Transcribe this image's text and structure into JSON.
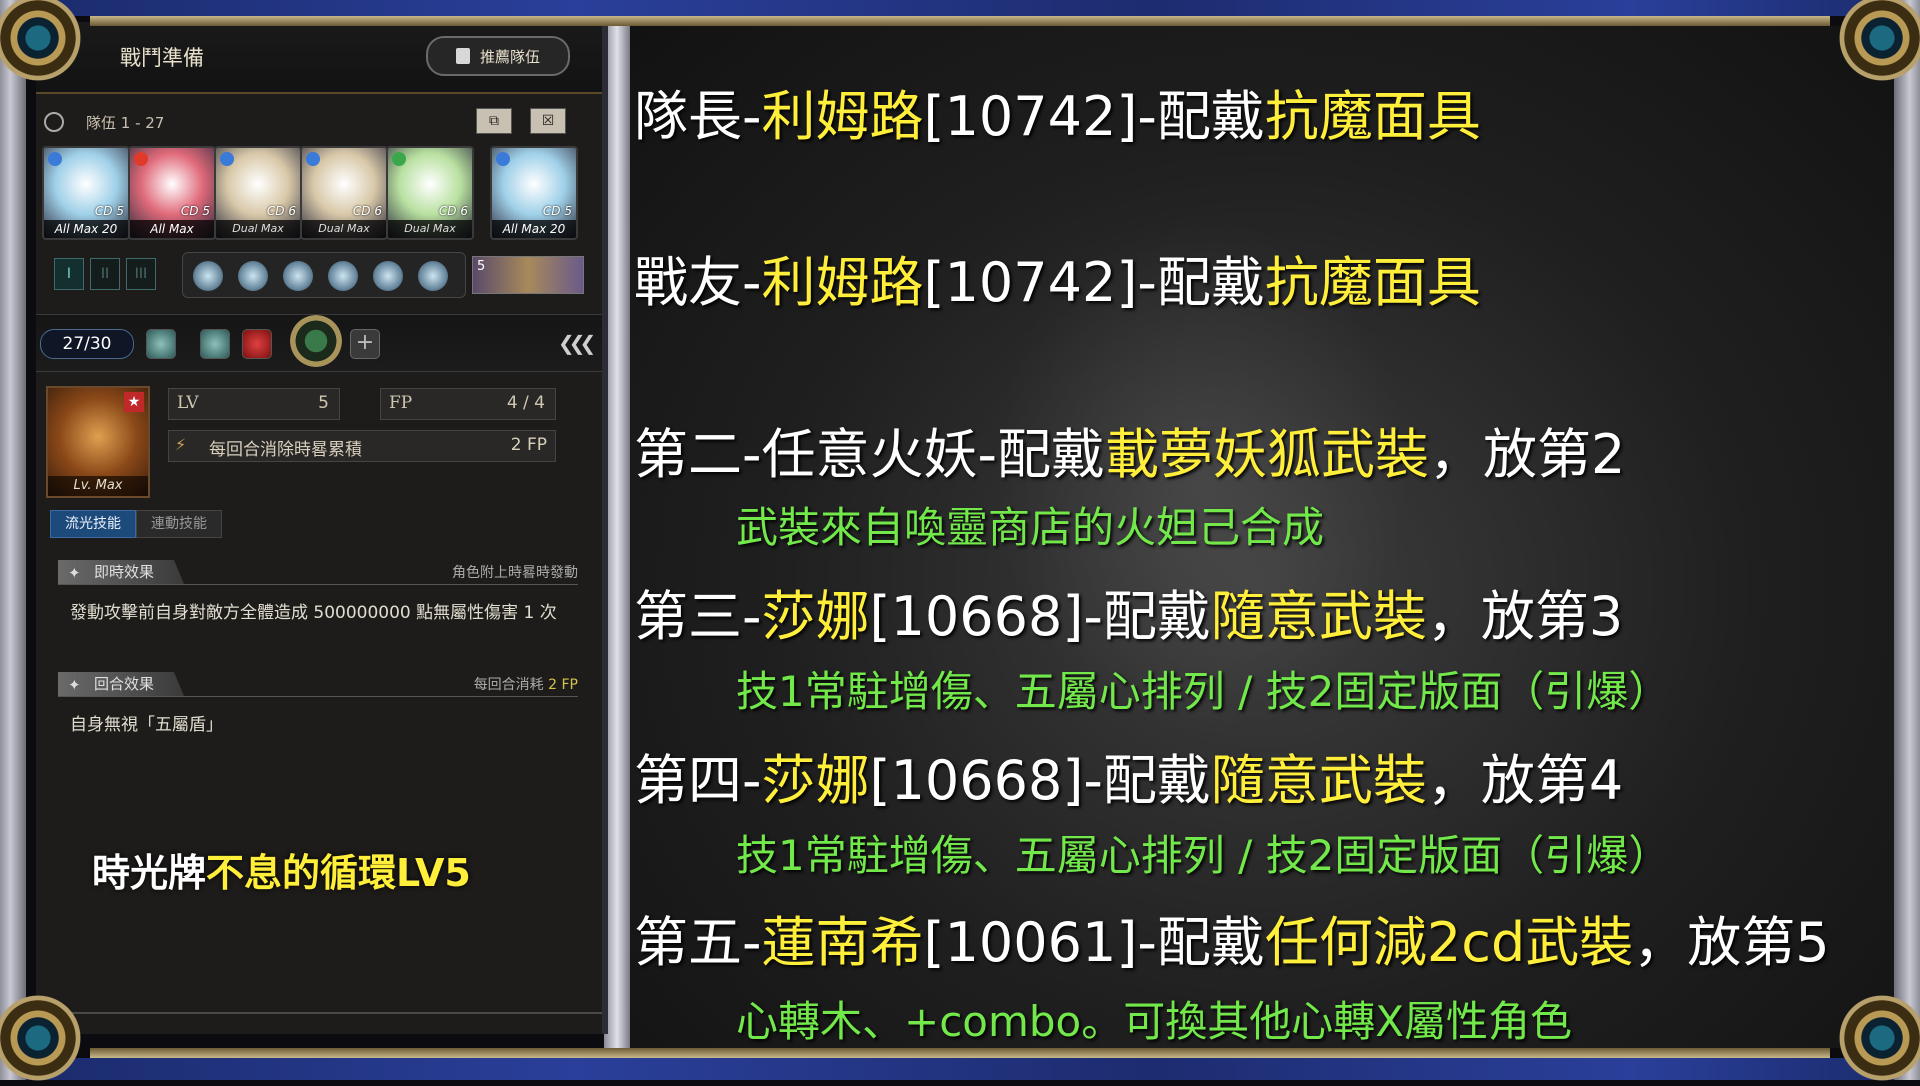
{
  "panel": {
    "title": "戰鬥準備",
    "recommend_btn": "推薦隊伍",
    "team_label": "隊伍 1 - 27",
    "cards": [
      {
        "cd": "CD 5",
        "tag": "All Max",
        "level": "20",
        "color": "#9fd0e8",
        "attr": "#3a7ad8"
      },
      {
        "cd": "CD 5",
        "tag": "All Max",
        "level": "",
        "color": "#e06a7a",
        "attr": "#e03a2a"
      },
      {
        "cd": "CD 6",
        "tag": "Dual Max",
        "level": "",
        "color": "#d8c8a8",
        "attr": "#3a7ad8"
      },
      {
        "cd": "CD 6",
        "tag": "Dual Max",
        "level": "",
        "color": "#d8c8a8",
        "attr": "#3a7ad8"
      },
      {
        "cd": "CD 6",
        "tag": "Dual Max",
        "level": "",
        "color": "#b8e0a0",
        "attr": "#3aa84a"
      },
      {
        "cd": "CD 5",
        "tag": "All Max",
        "level": "20",
        "color": "#9fd0e8",
        "attr": "#3a7ad8"
      }
    ],
    "slot_labels": [
      "I",
      "II",
      "III"
    ],
    "sword_count": "5",
    "counter": "27/30",
    "card_level_tag": "Lv. Max",
    "lv_key": "LV",
    "lv_val": "5",
    "fp_key": "FP",
    "fp_val": "4 / 4",
    "fp_desc": "每回合消除時晷累積",
    "fp_gain": "2 FP",
    "tab_active": "流光技能",
    "tab_inactive": "連動技能",
    "effect1": {
      "title": "即時效果",
      "note": "角色附上時晷時發動",
      "text": "發動攻擊前自身對敵方全體造成 500000000 點無屬性傷害 1 次"
    },
    "effect2": {
      "title": "回合效果",
      "note_prefix": "每回合消耗",
      "note_value": "2 FP",
      "text": "自身無視「五屬盾」"
    },
    "timecard_prefix": "時光牌",
    "timecard_name": "不息的循環LV5"
  },
  "lines": [
    {
      "parts": [
        {
          "t": "隊長-",
          "y": false
        },
        {
          "t": "利姆路",
          "y": true
        },
        {
          "t": "[10742]-配戴",
          "y": false
        },
        {
          "t": "抗魔面具",
          "y": true
        }
      ]
    },
    {
      "parts": [
        {
          "t": "戰友-",
          "y": false
        },
        {
          "t": "利姆路",
          "y": true
        },
        {
          "t": "[10742]-配戴",
          "y": false
        },
        {
          "t": "抗魔面具",
          "y": true
        }
      ]
    },
    {
      "parts": [
        {
          "t": "第二-任意火妖-配戴",
          "y": false
        },
        {
          "t": "載夢妖狐武裝",
          "y": true
        },
        {
          "t": "，放第2",
          "y": false
        }
      ]
    },
    {
      "parts": [
        {
          "t": "第三-",
          "y": false
        },
        {
          "t": "莎娜",
          "y": true
        },
        {
          "t": "[10668]-配戴",
          "y": false
        },
        {
          "t": "隨意武裝",
          "y": true
        },
        {
          "t": "，放第3",
          "y": false
        }
      ]
    },
    {
      "parts": [
        {
          "t": "第四-",
          "y": false
        },
        {
          "t": "莎娜",
          "y": true
        },
        {
          "t": "[10668]-配戴",
          "y": false
        },
        {
          "t": "隨意武裝",
          "y": true
        },
        {
          "t": "，放第4",
          "y": false
        }
      ]
    },
    {
      "parts": [
        {
          "t": "第五-",
          "y": false
        },
        {
          "t": "蓮南希",
          "y": true
        },
        {
          "t": "[10061]-配戴",
          "y": false
        },
        {
          "t": "任何減2cd武裝",
          "y": true
        },
        {
          "t": "，放第5",
          "y": false
        }
      ]
    }
  ],
  "sublines": [
    "武裝來自喚靈商店的火妲己合成",
    "技1常駐增傷、五屬心排列 / 技2固定版面（引爆）",
    "技1常駐增傷、五屬心排列 / 技2固定版面（引爆）",
    "心轉木、+combo。可換其他心轉X屬性角色"
  ]
}
